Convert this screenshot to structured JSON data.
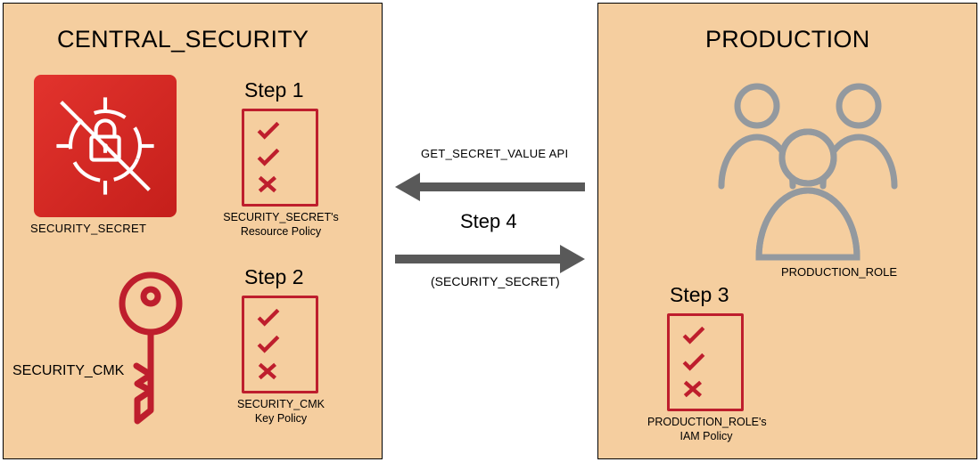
{
  "left_panel": {
    "title": "CENTRAL_SECURITY",
    "secret_caption": "SECURITY_SECRET",
    "key_caption": "SECURITY_CMK",
    "step1": {
      "label": "Step 1",
      "caption_line1": "SECURITY_SECRET's",
      "caption_line2": "Resource Policy"
    },
    "step2": {
      "label": "Step 2",
      "caption_line1": "SECURITY_CMK",
      "caption_line2": "Key Policy"
    }
  },
  "right_panel": {
    "title": "PRODUCTION",
    "role_caption": "PRODUCTION_ROLE",
    "step3": {
      "label": "Step 3",
      "caption_line1": "PRODUCTION_ROLE's",
      "caption_line2": "IAM Policy"
    }
  },
  "center": {
    "api_label": "GET_SECRET_VALUE API",
    "step4_label": "Step 4",
    "return_label": "(SECURITY_SECRET)"
  }
}
